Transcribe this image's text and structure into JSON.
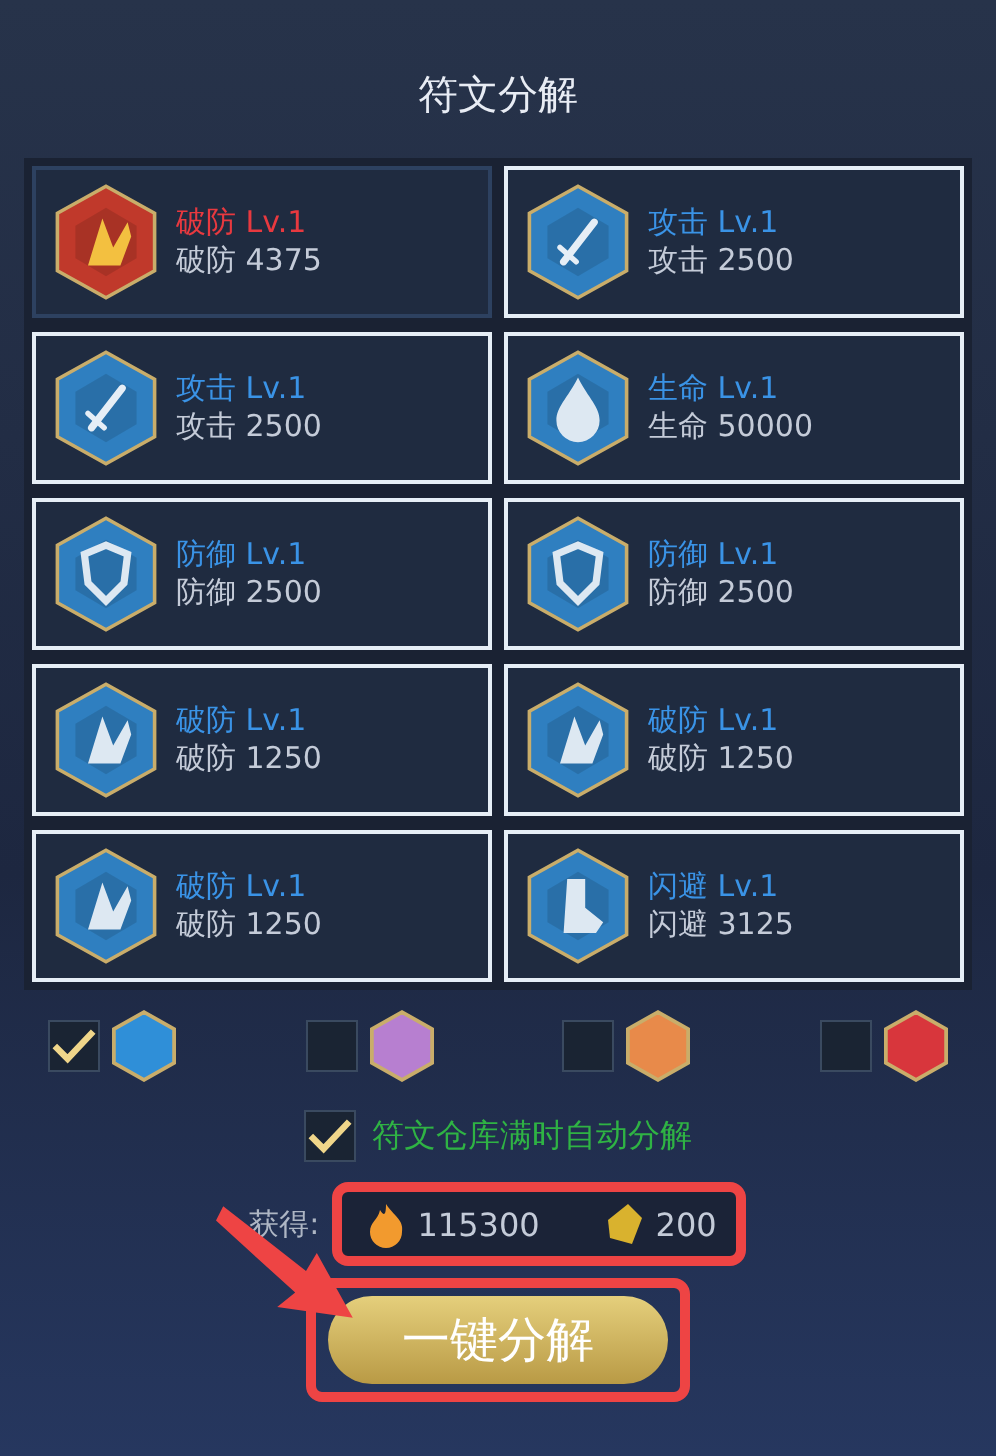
{
  "title": "符文分解",
  "runes": [
    {
      "kind": "pierce",
      "name": "破防",
      "level": "Lv.1",
      "stat": "破防 4375",
      "color": "#c0392b",
      "selected": false
    },
    {
      "kind": "attack",
      "name": "攻击",
      "level": "Lv.1",
      "stat": "攻击 2500",
      "color": "#2f7fc0",
      "selected": true
    },
    {
      "kind": "attack",
      "name": "攻击",
      "level": "Lv.1",
      "stat": "攻击 2500",
      "color": "#2f7fc0",
      "selected": true
    },
    {
      "kind": "life",
      "name": "生命",
      "level": "Lv.1",
      "stat": "生命 50000",
      "color": "#2f7fc0",
      "selected": true
    },
    {
      "kind": "defense",
      "name": "防御",
      "level": "Lv.1",
      "stat": "防御 2500",
      "color": "#2f7fc0",
      "selected": true
    },
    {
      "kind": "defense",
      "name": "防御",
      "level": "Lv.1",
      "stat": "防御 2500",
      "color": "#2f7fc0",
      "selected": true
    },
    {
      "kind": "pierce",
      "name": "破防",
      "level": "Lv.1",
      "stat": "破防 1250",
      "color": "#2f7fc0",
      "selected": true
    },
    {
      "kind": "pierce",
      "name": "破防",
      "level": "Lv.1",
      "stat": "破防 1250",
      "color": "#2f7fc0",
      "selected": true
    },
    {
      "kind": "pierce",
      "name": "破防",
      "level": "Lv.1",
      "stat": "破防 1250",
      "color": "#2f7fc0",
      "selected": true
    },
    {
      "kind": "dodge",
      "name": "闪避",
      "level": "Lv.1",
      "stat": "闪避 3125",
      "color": "#2f7fc0",
      "selected": true
    }
  ],
  "filters": [
    {
      "color": "#2f8fd8",
      "checked": true
    },
    {
      "color": "#b77fd0",
      "checked": false
    },
    {
      "color": "#e88a4a",
      "checked": false
    },
    {
      "color": "#d8363c",
      "checked": false
    }
  ],
  "auto": {
    "label": "符文仓库满时自动分解",
    "checked": true
  },
  "rewards": {
    "label": "获得:",
    "items": [
      {
        "kind": "fire",
        "amount": "115300"
      },
      {
        "kind": "crystal",
        "amount": "200"
      }
    ]
  },
  "button": "一键分解"
}
